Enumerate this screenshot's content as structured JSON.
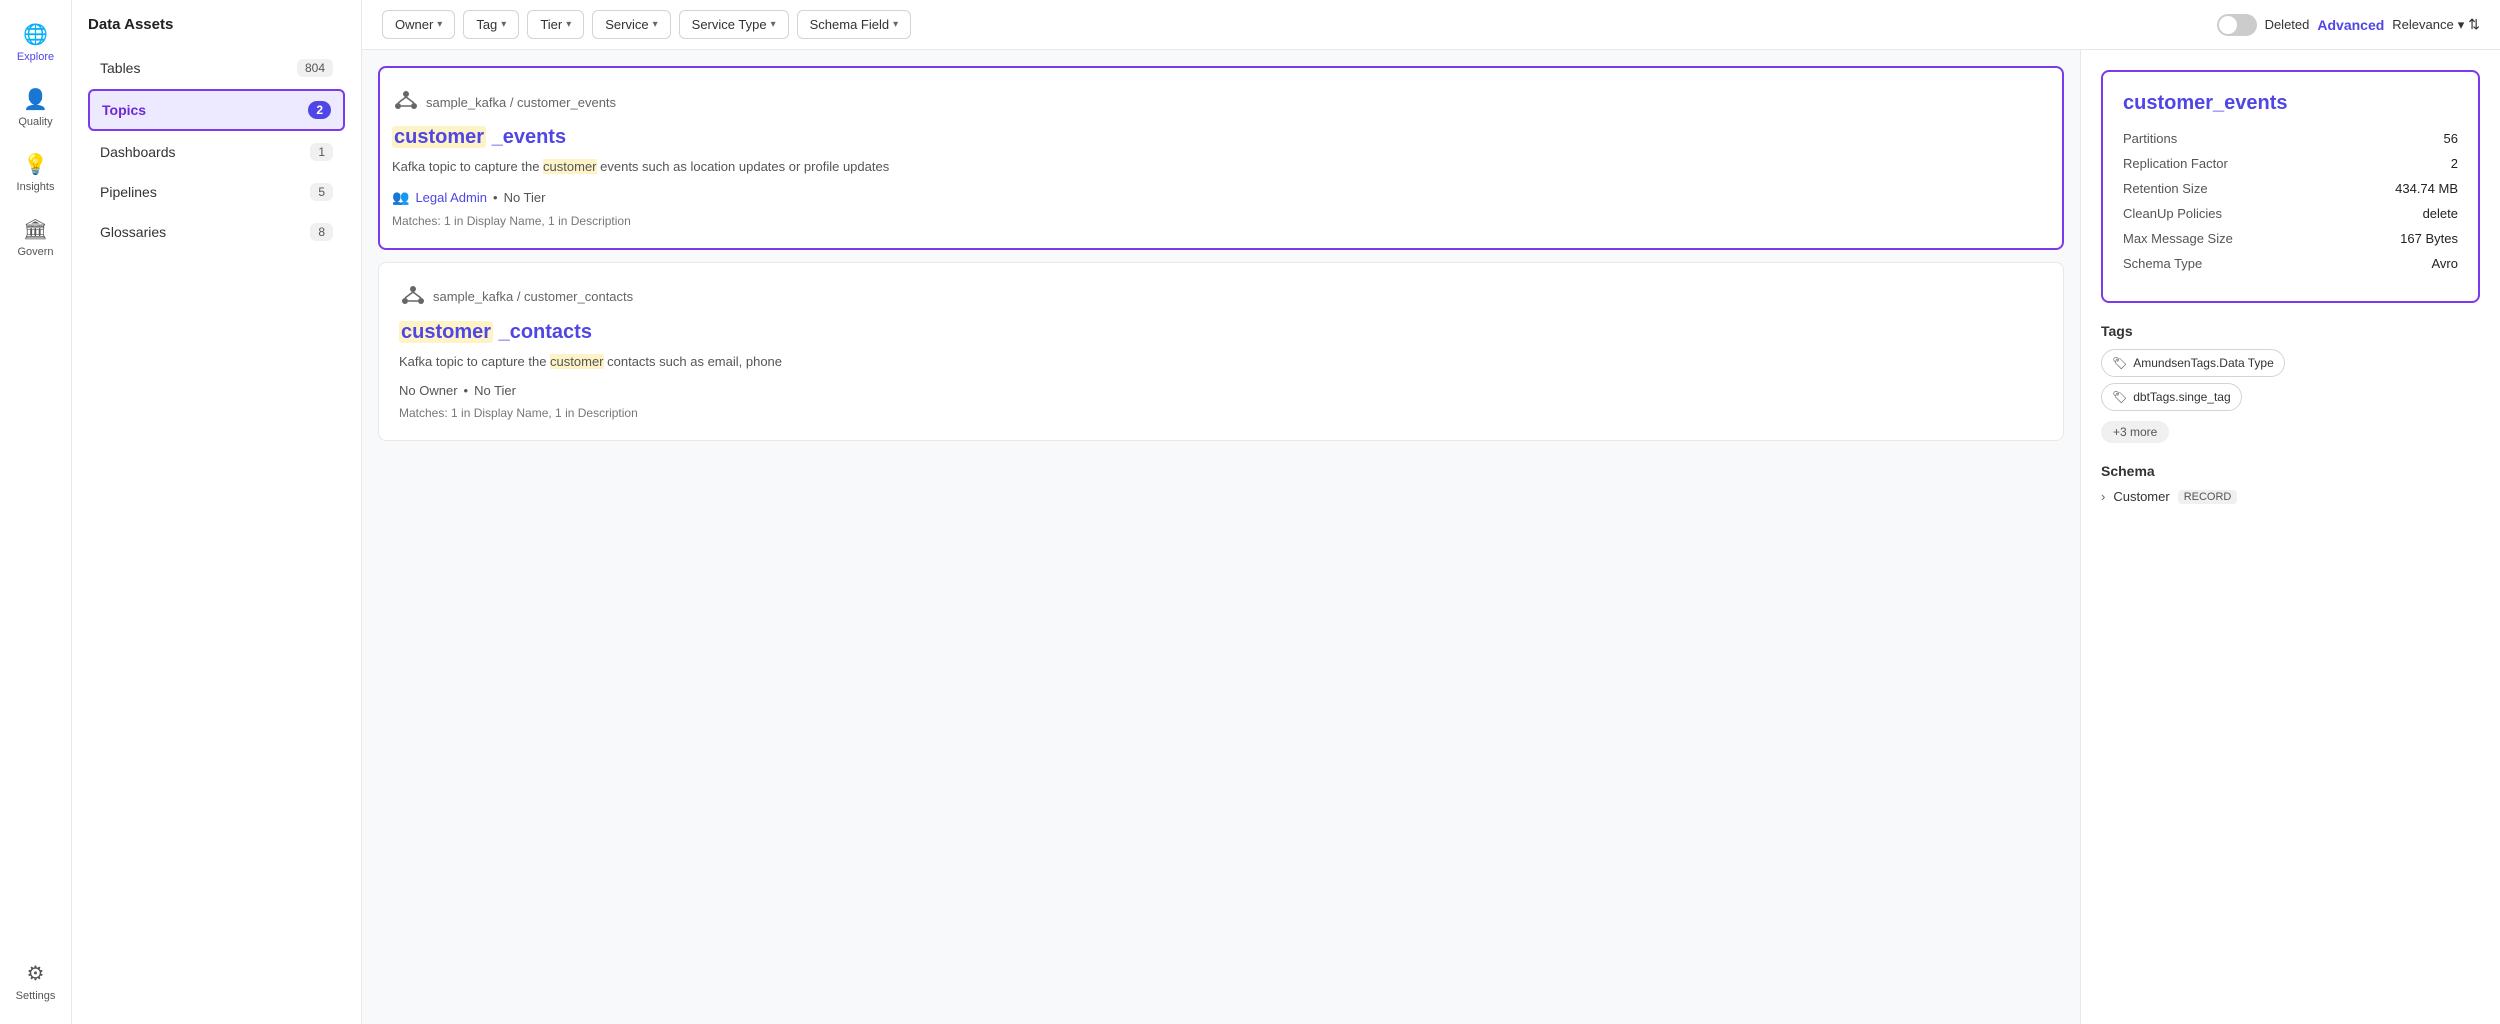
{
  "sidebar": {
    "items": [
      {
        "id": "explore",
        "label": "Explore",
        "icon": "🔍",
        "active": true
      },
      {
        "id": "quality",
        "label": "Quality",
        "icon": "⭐",
        "active": false
      },
      {
        "id": "insights",
        "label": "Insights",
        "icon": "💡",
        "active": false
      },
      {
        "id": "govern",
        "label": "Govern",
        "icon": "🏛",
        "active": false
      },
      {
        "id": "settings",
        "label": "Settings",
        "icon": "⚙",
        "active": false
      }
    ]
  },
  "leftPanel": {
    "title": "Data Assets",
    "navItems": [
      {
        "id": "tables",
        "label": "Tables",
        "count": "804",
        "active": false
      },
      {
        "id": "topics",
        "label": "Topics",
        "count": "2",
        "active": true
      },
      {
        "id": "dashboards",
        "label": "Dashboards",
        "count": "1",
        "active": false
      },
      {
        "id": "pipelines",
        "label": "Pipelines",
        "count": "5",
        "active": false
      },
      {
        "id": "glossaries",
        "label": "Glossaries",
        "count": "8",
        "active": false
      }
    ]
  },
  "filterBar": {
    "filters": [
      {
        "id": "owner",
        "label": "Owner"
      },
      {
        "id": "tag",
        "label": "Tag"
      },
      {
        "id": "tier",
        "label": "Tier"
      },
      {
        "id": "service",
        "label": "Service"
      },
      {
        "id": "service-type",
        "label": "Service Type"
      },
      {
        "id": "schema-field",
        "label": "Schema Field"
      }
    ],
    "deleted_label": "Deleted",
    "advanced_label": "Advanced",
    "relevance_label": "Relevance"
  },
  "results": [
    {
      "id": "customer_events",
      "breadcrumb": "sample_kafka / customer_events",
      "title_parts": [
        "customer",
        " _events"
      ],
      "description": "Kafka topic to capture the customer events such as location updates or profile updates",
      "highlight_word": "customer",
      "owner": "Legal Admin",
      "tier": "No Tier",
      "matches": "Matches:  1 in Display Name,  1 in Description",
      "selected": true
    },
    {
      "id": "customer_contacts",
      "breadcrumb": "sample_kafka / customer_contacts",
      "title_parts": [
        "customer",
        " _contacts"
      ],
      "description": "Kafka topic to capture the customer contacts such as email, phone",
      "highlight_word": "customer",
      "owner": null,
      "tier": "No Tier",
      "matches": "Matches:  1 in Display Name,  1 in Description",
      "selected": false
    }
  ],
  "detailPanel": {
    "title": "customer_events",
    "properties": [
      {
        "key": "Partitions",
        "value": "56"
      },
      {
        "key": "Replication Factor",
        "value": "2"
      },
      {
        "key": "Retention Size",
        "value": "434.74 MB"
      },
      {
        "key": "CleanUp Policies",
        "value": "delete"
      },
      {
        "key": "Max Message Size",
        "value": "167 Bytes"
      },
      {
        "key": "Schema Type",
        "value": "Avro"
      }
    ],
    "tags_title": "Tags",
    "tags": [
      {
        "label": "AmundsenTags.Data Type"
      },
      {
        "label": "dbtTags.singe_tag"
      }
    ],
    "more_tags": "+3 more",
    "schema_title": "Schema",
    "schema_item": "Customer",
    "schema_item_type": "RECORD"
  }
}
